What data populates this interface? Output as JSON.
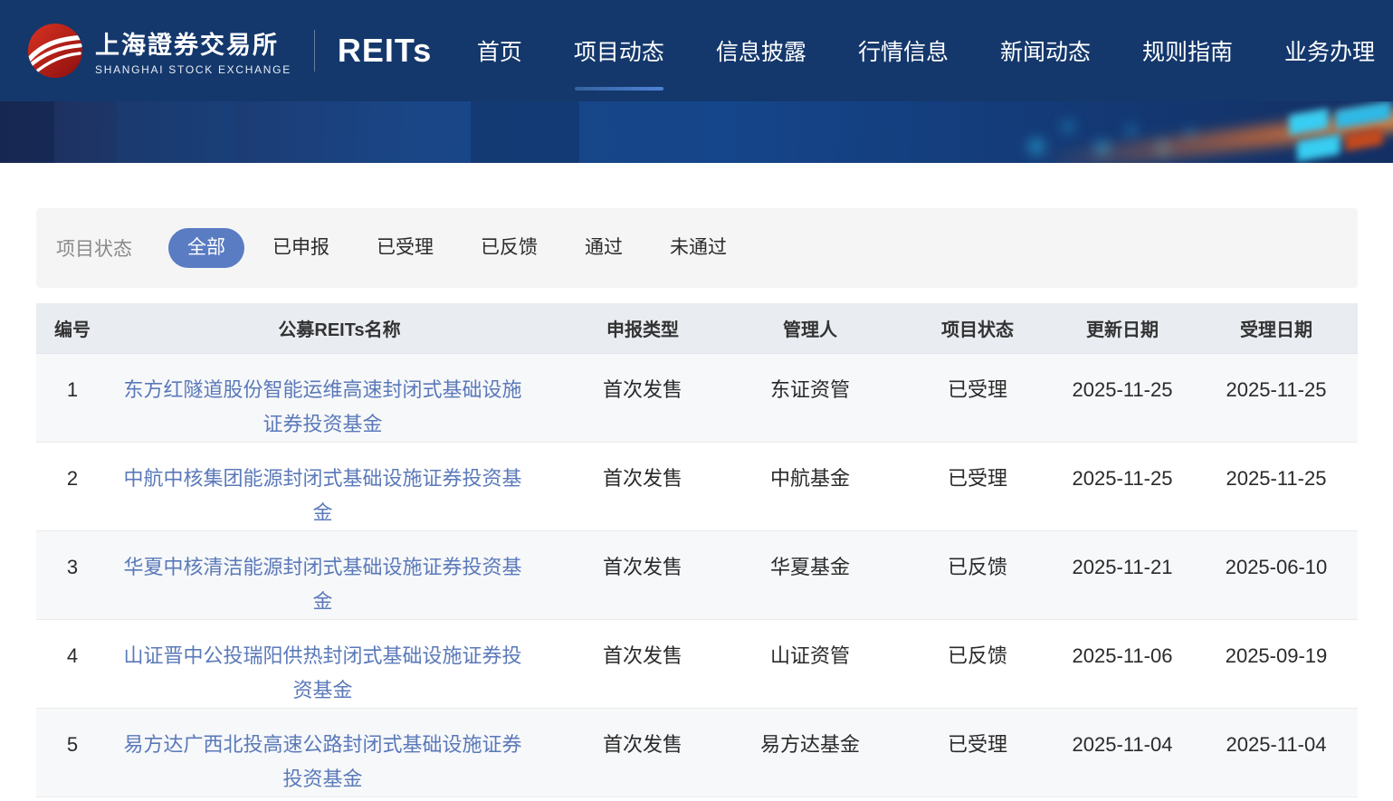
{
  "header": {
    "brand": {
      "logo_icon": "sse-red-globe",
      "name_zh": "上海證券交易所",
      "name_en": "SHANGHAI STOCK EXCHANGE",
      "product": "REITs"
    },
    "nav_items": [
      {
        "label": "首页",
        "active": false
      },
      {
        "label": "项目动态",
        "active": true
      },
      {
        "label": "信息披露",
        "active": false
      },
      {
        "label": "行情信息",
        "active": false
      },
      {
        "label": "新闻动态",
        "active": false
      },
      {
        "label": "规则指南",
        "active": false
      },
      {
        "label": "业务办理",
        "active": false
      }
    ]
  },
  "filter": {
    "label": "项目状态",
    "options": [
      {
        "label": "全部",
        "selected": true
      },
      {
        "label": "已申报",
        "selected": false
      },
      {
        "label": "已受理",
        "selected": false
      },
      {
        "label": "已反馈",
        "selected": false
      },
      {
        "label": "通过",
        "selected": false
      },
      {
        "label": "未通过",
        "selected": false
      }
    ]
  },
  "table": {
    "columns": [
      "编号",
      "公募REITs名称",
      "申报类型",
      "管理人",
      "项目状态",
      "更新日期",
      "受理日期"
    ],
    "rows": [
      {
        "no": "1",
        "name": "东方红隧道股份智能运维高速封闭式基础设施证券投资基金",
        "type": "首次发售",
        "manager": "东证资管",
        "status": "已受理",
        "update_date": "2025-11-25",
        "accept_date": "2025-11-25"
      },
      {
        "no": "2",
        "name": "中航中核集团能源封闭式基础设施证券投资基金",
        "type": "首次发售",
        "manager": "中航基金",
        "status": "已受理",
        "update_date": "2025-11-25",
        "accept_date": "2025-11-25"
      },
      {
        "no": "3",
        "name": "华夏中核清洁能源封闭式基础设施证券投资基金",
        "type": "首次发售",
        "manager": "华夏基金",
        "status": "已反馈",
        "update_date": "2025-11-21",
        "accept_date": "2025-06-10"
      },
      {
        "no": "4",
        "name": "山证晋中公投瑞阳供热封闭式基础设施证券投资基金",
        "type": "首次发售",
        "manager": "山证资管",
        "status": "已反馈",
        "update_date": "2025-11-06",
        "accept_date": "2025-09-19"
      },
      {
        "no": "5",
        "name": "易方达广西北投高速公路封闭式基础设施证券投资基金",
        "type": "首次发售",
        "manager": "易方达基金",
        "status": "已受理",
        "update_date": "2025-11-04",
        "accept_date": "2025-11-04"
      }
    ]
  },
  "colors": {
    "navbar_bg": "#14386C",
    "selected_pill": "#5A7CC3",
    "fund_link": "#5A79B9",
    "active_underline": "#4E82D6",
    "table_header_bg": "#E9EDF2",
    "filter_bar_bg": "#F5F5F6",
    "zebra_row_bg": "#F7F8FA"
  }
}
